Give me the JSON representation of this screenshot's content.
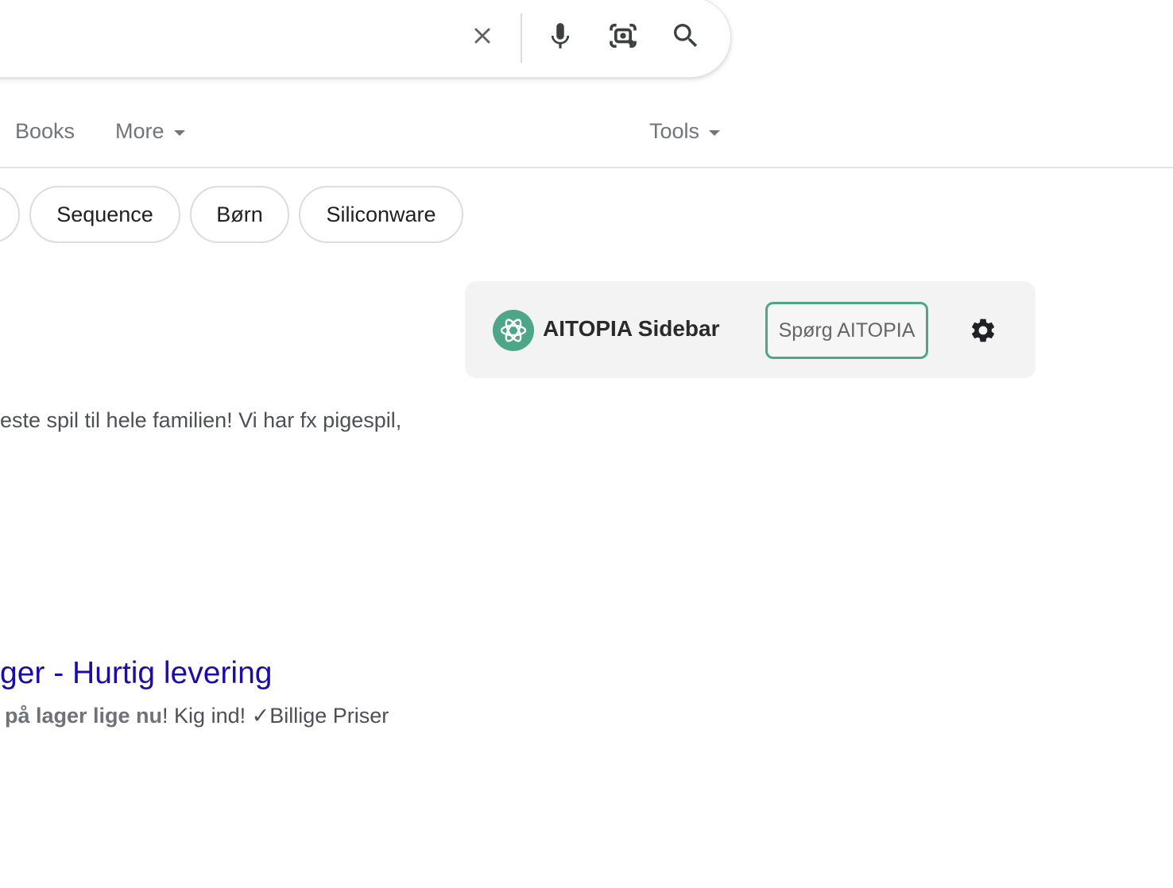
{
  "search": {
    "clear_icon": "close-icon",
    "voice_icon": "microphone-icon",
    "lens_icon": "camera-lens-icon",
    "search_icon": "search-icon"
  },
  "tabs": {
    "books": "Books",
    "more": "More",
    "tools": "Tools"
  },
  "chips": [
    "Sequence",
    "Børn",
    "Siliconware"
  ],
  "aitopia": {
    "title": "AITOPIA Sidebar",
    "ask_button": "Spørg AITOPIA",
    "accent_color": "#4ca687",
    "settings_icon": "gear-icon"
  },
  "results": {
    "snippet": "este spil til hele familien! Vi har fx pigespil,",
    "title": "ger - Hurtig levering",
    "desc_bold": "på lager lige nu",
    "desc_rest": "! Kig ind! ✓Billige Priser"
  },
  "colors": {
    "link": "#1a0dab",
    "text_secondary": "#70757a"
  }
}
